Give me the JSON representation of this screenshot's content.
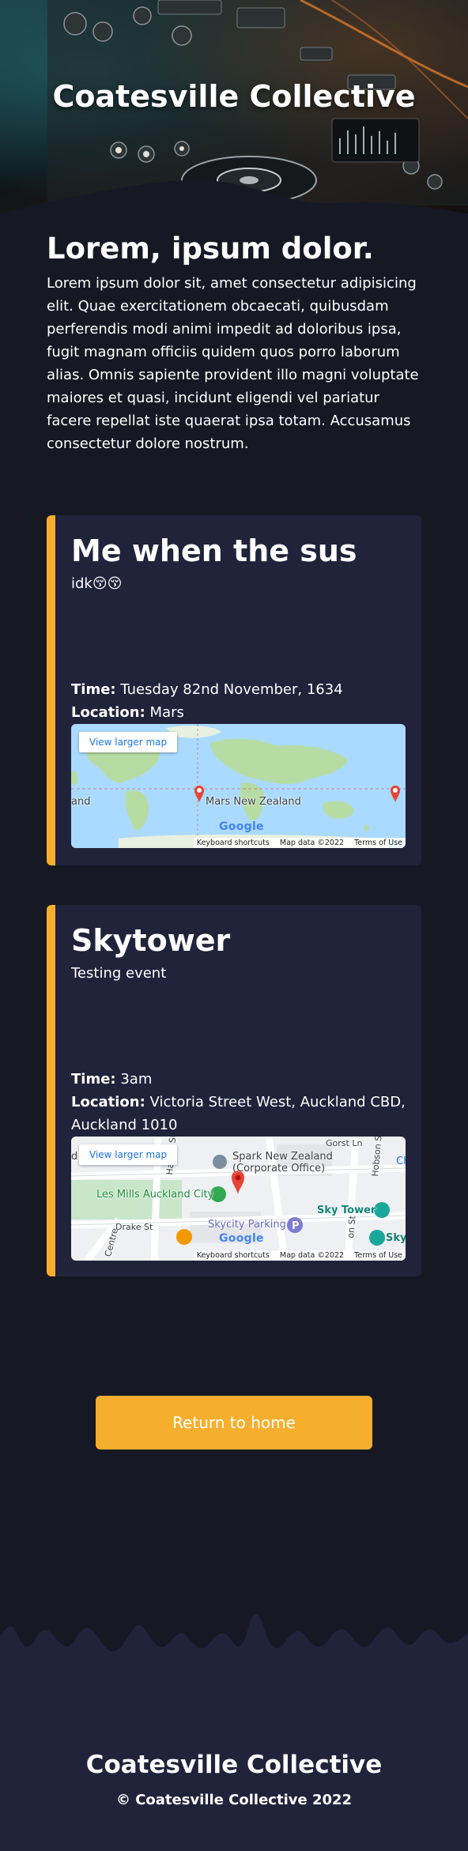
{
  "site": {
    "title": "Coatesville Collective"
  },
  "intro": {
    "heading": "Lorem, ipsum dolor.",
    "text": "Lorem ipsum dolor sit, amet consectetur adipisicing elit. Quae exercitationem obcaecati, quibusdam perferendis modi animi impedit ad doloribus ipsa, fugit magnam officiis quidem quos porro laborum alias. Omnis sapiente provident illo magni voluptate maiores et quasi, incidunt eligendi vel pariatur facere repellat iste quaerat ipsa totam. Accusamus consectetur dolore nostrum."
  },
  "labels": {
    "time": "Time:",
    "location": "Location:"
  },
  "events": [
    {
      "title": "Me when the sus",
      "description": "idk😚😚",
      "time": "Tuesday 82nd November, 1634",
      "location": "Mars",
      "map": {
        "button": "View larger map",
        "place_label": "Mars New Zealand",
        "edge_label": "and",
        "logo": "Google",
        "footer": [
          "Keyboard shortcuts",
          "Map data ©2022",
          "Terms of Use"
        ]
      }
    },
    {
      "title": "Skytower",
      "description": "Testing event",
      "time": "3am",
      "location": "Victoria Street West, Auckland CBD, Auckland 1010",
      "map": {
        "button": "View larger map",
        "labels": {
          "spark": "Spark New Zealand",
          "spark_sub": "(Corporate Office)",
          "les_mills": "Les Mills Auckland City",
          "sky_tower": "Sky Tower",
          "skycity_parking": "Skycity Parking",
          "drake_st": "Drake St",
          "gorst_ln": "Gorst Ln",
          "hobson": "Hobson St",
          "halsey": "Halsey St",
          "centre": "Centre",
          "sky": "Sky",
          "on_st": "on St",
          "ch": "Ch",
          "edge": "d"
        },
        "logo": "Google",
        "footer": [
          "Keyboard shortcuts",
          "Map data ©2022",
          "Terms of Use"
        ]
      }
    }
  ],
  "actions": {
    "return_home": "Return to home"
  },
  "footer": {
    "title": "Coatesville Collective",
    "copyright": "© Coatesville Collective 2022"
  },
  "colors": {
    "background": "#161924",
    "card": "#20233a",
    "accent": "#f6ae2d"
  }
}
